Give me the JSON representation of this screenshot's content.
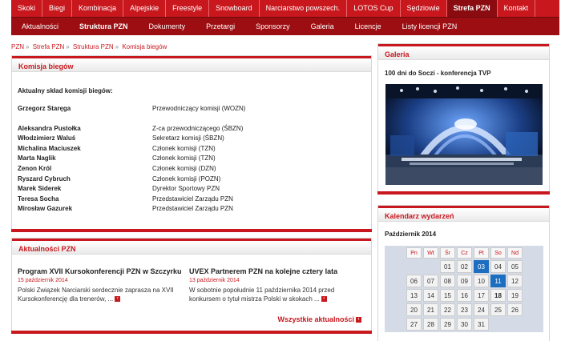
{
  "top_nav": [
    "Skoki",
    "Biegi",
    "Kombinacja",
    "Alpejskie",
    "Freestyle",
    "Snowboard",
    "Narciarstwo powszech.",
    "LOTOS Cup",
    "Sędziowie",
    "Strefa PZN",
    "Kontakt"
  ],
  "sub_nav": [
    "Aktualności",
    "Struktura PZN",
    "Dokumenty",
    "Przetargi",
    "Sponsorzy",
    "Galeria",
    "Licencje",
    "Listy licencji PZN"
  ],
  "breadcrumb": [
    "PZN",
    "Strefa PZN",
    "Struktura PZN",
    "Komisja biegów"
  ],
  "committee": {
    "title": "Komisja biegów",
    "intro": "Aktualny skład komisji biegów:",
    "members": [
      {
        "name": "Grzegorz Staręga",
        "role": "Przewodniczący komisji  (WOZN)"
      },
      {
        "name": "Aleksandra Pustołka",
        "role": "Z-ca przewodniczącego  (ŚBZN)"
      },
      {
        "name": "Włodzimierz Waluś",
        "role": "Sekretarz  komisji  (ŚBZN)"
      },
      {
        "name": "Michalina Maciuszek",
        "role": "Członek  komisji  (TZN)"
      },
      {
        "name": "Marta Naglik",
        "role": "Członek  komisji  (TZN)"
      },
      {
        "name": "Zenon Król",
        "role": "Członek  komisji  (DZN)"
      },
      {
        "name": "Ryszard Cybruch",
        "role": "Członek  komisji  (POZN)"
      },
      {
        "name": "Marek Siderek",
        "role": "Dyrektor Sportowy PZN"
      },
      {
        "name": "Teresa Socha",
        "role": "Przedstawiciel Zarządu PZN"
      },
      {
        "name": "Mirosław Gazurek",
        "role": "Przedstawiciel Zarządu PZN"
      }
    ]
  },
  "news": {
    "title": "Aktualności PZN",
    "items": [
      {
        "title": "Program XVII Kursokonferencji PZN w Szczyrku",
        "date": "15 październik 2014",
        "text": "Polski Związek Narciarski serdecznie zaprasza na XVII Kursokonferencję dla trenerów, ..."
      },
      {
        "title": "UVEX Partnerem PZN na kolejne cztery lata",
        "date": "13 październik 2014",
        "text": "W sobotnie popołudnie 11 października 2014 przed konkursem o tytuł mistrza Polski w skokach ..."
      }
    ],
    "all_label": "Wszystkie aktualności"
  },
  "gallery": {
    "title": "Galeria",
    "caption": "100 dni do Soczi - konferencja TVP"
  },
  "calendar": {
    "title": "Kalendarz wydarzeń",
    "month": "Październik 2014",
    "weekdays": [
      "Pn",
      "Wt",
      "Śr",
      "Cz",
      "Pt",
      "So",
      "Nd"
    ],
    "weeks": [
      [
        "",
        "",
        "01",
        "02",
        "03",
        "04",
        "05"
      ],
      [
        "06",
        "07",
        "08",
        "09",
        "10",
        "11",
        "12"
      ],
      [
        "13",
        "14",
        "15",
        "16",
        "17",
        "18",
        "19"
      ],
      [
        "20",
        "21",
        "22",
        "23",
        "24",
        "25",
        "26"
      ],
      [
        "27",
        "28",
        "29",
        "30",
        "31",
        "",
        ""
      ]
    ],
    "selected": [
      "03",
      "11"
    ],
    "bold": [
      "18"
    ]
  },
  "colors": {
    "accent": "#c8181e",
    "dark_accent": "#9c0e12",
    "selected": "#1e6ec0"
  }
}
